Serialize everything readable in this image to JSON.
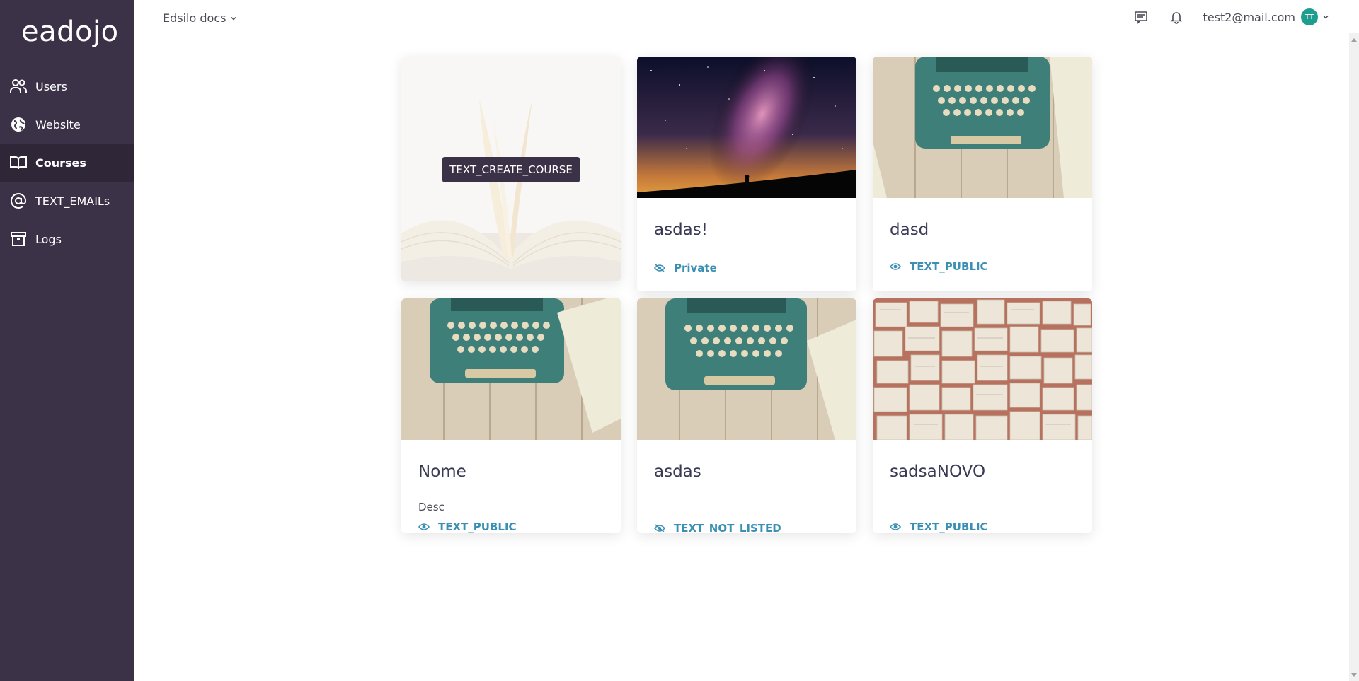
{
  "brand": {
    "logo": "eadojo"
  },
  "sidebar": {
    "items": [
      {
        "label": "Users",
        "icon": "users-icon",
        "active": false
      },
      {
        "label": "Website",
        "icon": "globe-icon",
        "active": false
      },
      {
        "label": "Courses",
        "icon": "book-icon",
        "active": true
      },
      {
        "label": "TEXT_EMAILs",
        "icon": "at-sign-icon",
        "active": false
      },
      {
        "label": "Logs",
        "icon": "archive-icon",
        "active": false
      }
    ]
  },
  "header": {
    "workspace": "Edsilo docs",
    "user_email": "test2@mail.com",
    "avatar_initials": "TT"
  },
  "create_card": {
    "button_label": "TEXT_CREATE_COURSE"
  },
  "courses": [
    {
      "title": "asdas!",
      "description": "",
      "visibility": "Private",
      "visibility_icon": "eye-slash-icon",
      "image": "galaxy"
    },
    {
      "title": "dasd",
      "description": "",
      "visibility": "TEXT_PUBLIC",
      "visibility_icon": "eye-icon",
      "image": "typewriter"
    },
    {
      "title": "Nome",
      "description": "Desc",
      "visibility": "TEXT_PUBLIC",
      "visibility_icon": "eye-icon",
      "image": "typewriter"
    },
    {
      "title": "asdas",
      "description": "",
      "visibility": "TEXT_NOT_LISTED",
      "visibility_icon": "eye-slash-icon",
      "image": "typewriter"
    },
    {
      "title": "sadsaNOVO",
      "description": "",
      "visibility": "TEXT_PUBLIC",
      "visibility_icon": "eye-icon",
      "image": "books"
    }
  ],
  "colors": {
    "sidebar": "#3c3248",
    "sidebar_active": "#2f2738",
    "accent": "#3b8fb3",
    "avatar": "#1f9e8f"
  }
}
